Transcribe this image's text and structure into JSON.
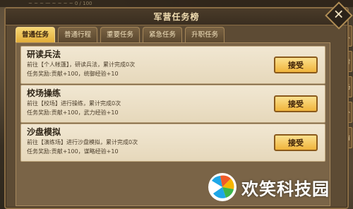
{
  "background": {
    "top_text": "~ ~ ~ 一 ~ ~ ~ ~ 0 / 100",
    "side_tags": [
      "人",
      "背",
      "场",
      "外",
      "首"
    ]
  },
  "panel": {
    "title": "军营任务榜",
    "close_label": "✕"
  },
  "tabs": [
    {
      "label": "普通任务",
      "active": true
    },
    {
      "label": "普通行程",
      "active": false
    },
    {
      "label": "重要任务",
      "active": false
    },
    {
      "label": "紧急任务",
      "active": false
    },
    {
      "label": "升职任务",
      "active": false
    }
  ],
  "quests": [
    {
      "name": "研读兵法",
      "desc": "前往【个人帐篷】，研读兵法，累计完成0次",
      "reward": "任务奖励:贡献+100，统御经验+10",
      "button": "接受"
    },
    {
      "name": "校场操练",
      "desc": "前往【校场】进行操练，累计完成0次",
      "reward": "任务奖励:贡献+100，武力经验+10",
      "button": "接受"
    },
    {
      "name": "沙盘模拟",
      "desc": "前往【演练场】进行沙盘模拟，累计完成0次",
      "reward": "任务奖励:贡献+100，谋略经验+10",
      "button": "接受"
    }
  ],
  "watermark": {
    "text": "欢笑科技园",
    "logo_icon": "fan-logo-icon"
  }
}
